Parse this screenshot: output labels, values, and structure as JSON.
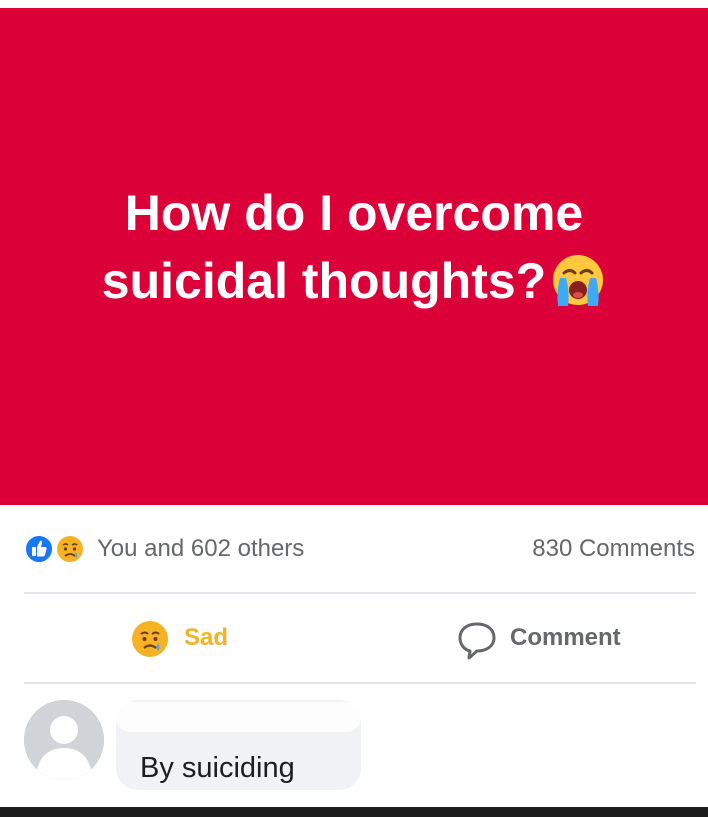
{
  "colors": {
    "banner_background": "#dc0039",
    "banner_text": "#ffffff",
    "like_blue": "#1877f2",
    "sad_yellow": "#f7b125",
    "secondary_text": "#65676b",
    "divider": "#e4e6eb",
    "comment_bubble": "#f0f2f5"
  },
  "post": {
    "banner_text": "How do I overcome suicidal thoughts?",
    "banner_emoji": "loudly-crying-face-icon"
  },
  "reactions": {
    "icons": [
      "like-icon",
      "sad-face-icon"
    ],
    "summary": "You and 602 others",
    "comments_count": "830 Comments"
  },
  "actions": {
    "sad_label": "Sad",
    "sad_icon": "sad-face-icon",
    "comment_label": "Comment",
    "comment_icon": "comment-bubble-icon"
  },
  "comment": {
    "avatar_icon": "default-avatar-icon",
    "text": "By suiciding"
  }
}
